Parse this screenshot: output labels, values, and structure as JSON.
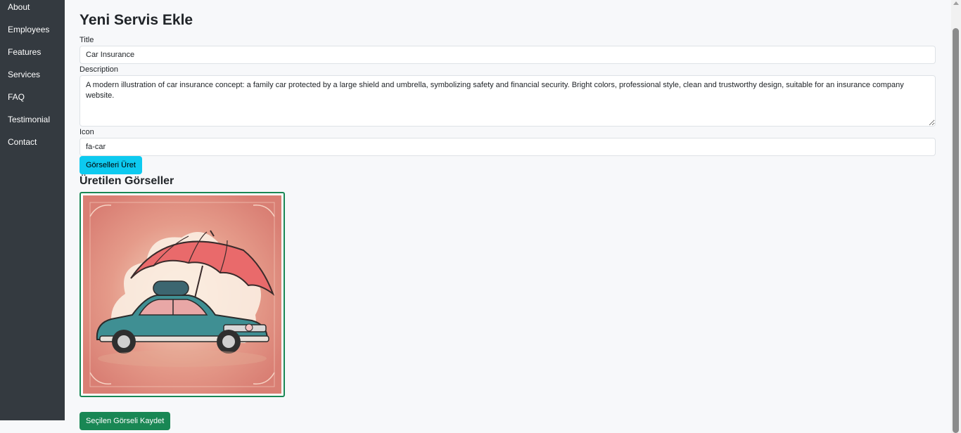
{
  "sidebar": {
    "items": [
      {
        "label": "About"
      },
      {
        "label": "Employees"
      },
      {
        "label": "Features"
      },
      {
        "label": "Services"
      },
      {
        "label": "FAQ"
      },
      {
        "label": "Testimonial"
      },
      {
        "label": "Contact"
      }
    ]
  },
  "page": {
    "title": "Yeni Servis Ekle"
  },
  "form": {
    "title_label": "Title",
    "title_value": "Car Insurance",
    "description_label": "Description",
    "description_value": "A modern illustration of car insurance concept: a family car protected by a large shield and umbrella, symbolizing safety and financial security. Bright colors, professional style, clean and trustworthy design, suitable for an insurance company website.",
    "icon_label": "Icon",
    "icon_value": "fa-car",
    "generate_button": "Görselleri Üret"
  },
  "generated": {
    "heading": "Üretilen Görseller",
    "images": [
      {
        "subject": "car-under-umbrella-illustration",
        "selected": true
      }
    ],
    "save_button": "Seçilen Görseli Kaydet"
  },
  "colors": {
    "sidebar_bg": "#343a40",
    "info": "#0dcaf0",
    "success": "#198754"
  }
}
